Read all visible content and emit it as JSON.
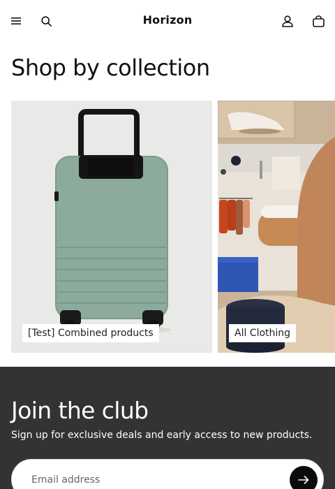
{
  "header": {
    "brand": "Horizon",
    "icons": {
      "menu": "menu-icon",
      "search": "search-icon",
      "account": "account-icon",
      "cart": "bag-icon"
    }
  },
  "collections": {
    "title": "Shop by collection",
    "items": [
      {
        "label": "[Test] Combined products",
        "image": "green carry-on suitcase"
      },
      {
        "label": "All Clothing",
        "image": "clothing store interior"
      }
    ]
  },
  "newsletter": {
    "title": "Join the club",
    "subtitle": "Sign up for exclusive deals and early access to new products.",
    "email_placeholder": "Email address",
    "submit_icon": "arrow-right-icon"
  },
  "colors": {
    "background": "#ffffff",
    "text": "#111111",
    "club_background": "#333333",
    "submit_button": "#0b0b0b"
  }
}
